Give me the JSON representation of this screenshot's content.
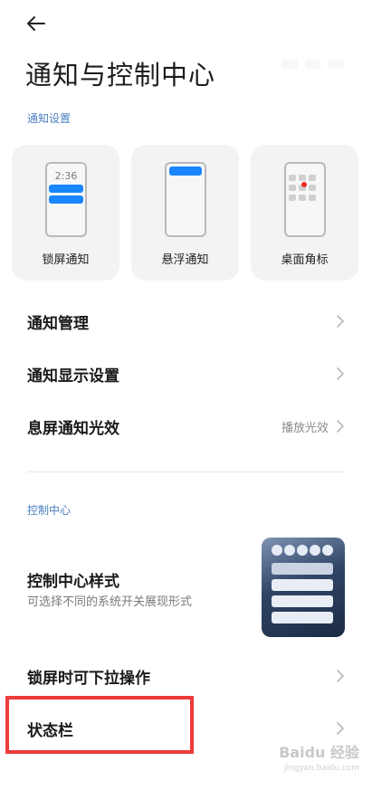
{
  "header": {
    "back_icon": "arrow-left-icon",
    "title": "通知与控制中心"
  },
  "notification_settings": {
    "section_label": "通知设置",
    "cards": [
      {
        "label": "锁屏通知",
        "icon": "lock-screen-notification-icon",
        "time": "2:36"
      },
      {
        "label": "悬浮通知",
        "icon": "floating-notification-icon"
      },
      {
        "label": "桌面角标",
        "icon": "desktop-badge-icon"
      }
    ],
    "items": [
      {
        "label": "通知管理",
        "value": ""
      },
      {
        "label": "通知显示设置",
        "value": ""
      },
      {
        "label": "息屏通知光效",
        "value": "播放光效"
      }
    ]
  },
  "control_center": {
    "section_label": "控制中心",
    "style": {
      "title": "控制中心样式",
      "subtitle": "可选择不同的系统开关展现形式"
    },
    "items": [
      {
        "label": "锁屏时可下拉操作"
      },
      {
        "label": "状态栏"
      }
    ]
  },
  "watermark": {
    "main": "Baidu 经验",
    "sub": "jingyan.baidu.com"
  },
  "colors": {
    "accent": "#1a86ff",
    "section_header": "#4a7fbf",
    "highlight": "#ec3b3b",
    "badge": "#ee2a2a"
  }
}
